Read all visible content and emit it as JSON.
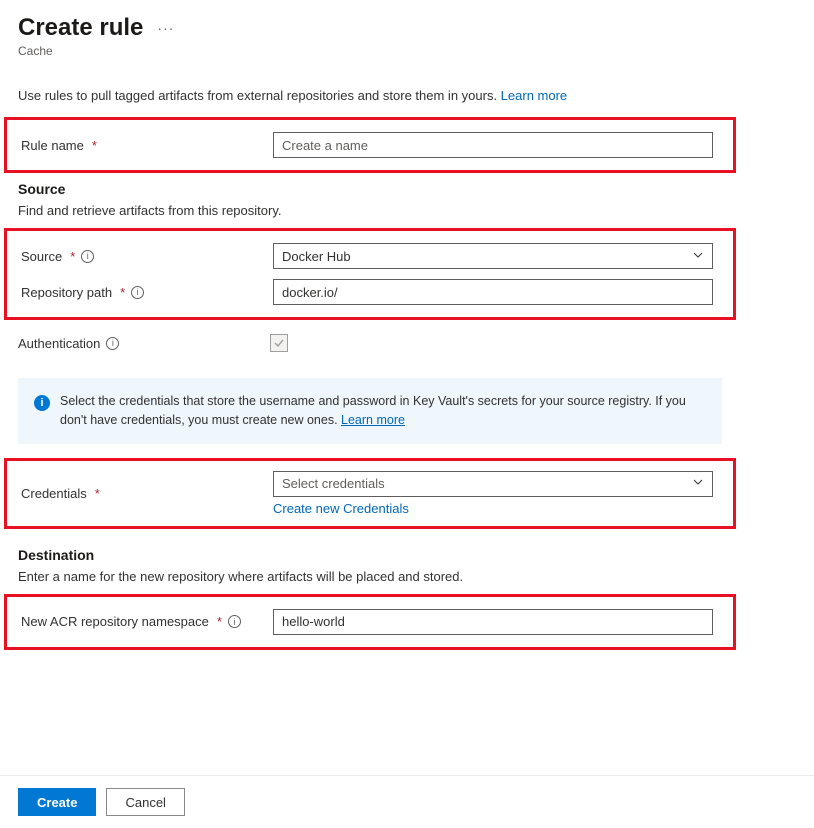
{
  "header": {
    "title": "Create rule",
    "subtitle": "Cache"
  },
  "intro": {
    "text": "Use rules to pull tagged artifacts from external repositories and store them in yours. ",
    "learn_more": "Learn more"
  },
  "rule_name": {
    "label": "Rule name",
    "placeholder": "Create a name",
    "value": ""
  },
  "source_section": {
    "heading": "Source",
    "desc": "Find and retrieve artifacts from this repository."
  },
  "source": {
    "label": "Source",
    "value": "Docker Hub"
  },
  "repo_path": {
    "label": "Repository path",
    "value": "docker.io/"
  },
  "authentication": {
    "label": "Authentication"
  },
  "banner": {
    "text": "Select the credentials that store the username and password in Key Vault's secrets for your source registry. If you don't have credentials, you must create new ones. ",
    "learn_more": "Learn more"
  },
  "credentials": {
    "label": "Credentials",
    "placeholder": "Select credentials",
    "create_link": "Create new Credentials"
  },
  "destination_section": {
    "heading": "Destination",
    "desc": "Enter a name for the new repository where artifacts will be placed and stored."
  },
  "acr_namespace": {
    "label": "New ACR repository namespace",
    "value": "hello-world"
  },
  "footer": {
    "create": "Create",
    "cancel": "Cancel"
  }
}
